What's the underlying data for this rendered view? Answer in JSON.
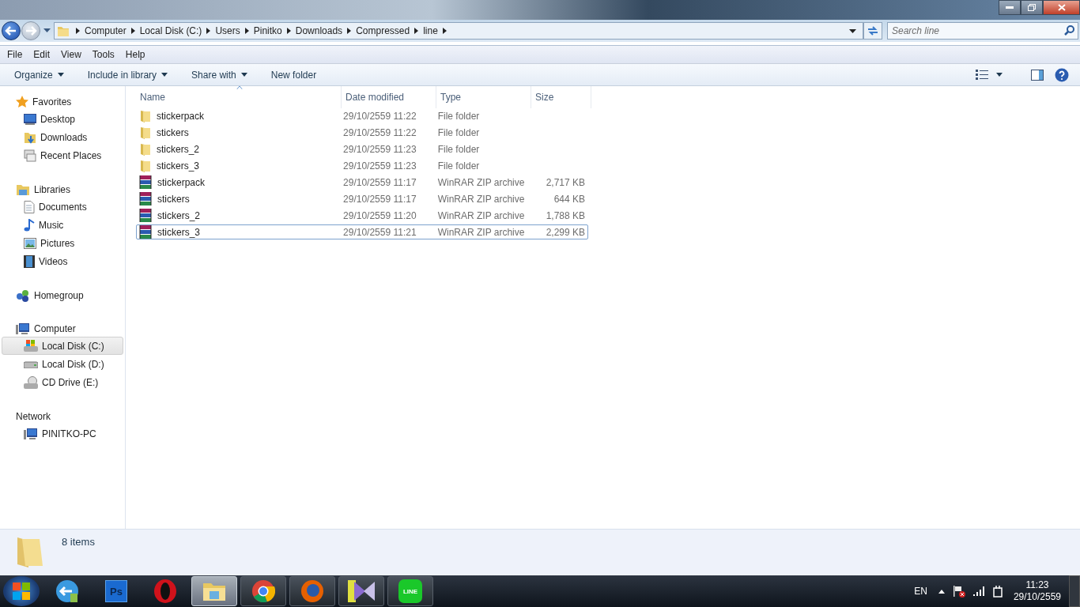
{
  "address": {
    "breadcrumbs": [
      "Computer",
      "Local Disk (C:)",
      "Users",
      "Pinitko",
      "Downloads",
      "Compressed",
      "line"
    ]
  },
  "search": {
    "placeholder": "Search line"
  },
  "menu": [
    "File",
    "Edit",
    "View",
    "Tools",
    "Help"
  ],
  "commands": [
    {
      "label": "Organize",
      "dropdown": true
    },
    {
      "label": "Include in library",
      "dropdown": true
    },
    {
      "label": "Share with",
      "dropdown": true
    },
    {
      "label": "New folder",
      "dropdown": false
    }
  ],
  "sidebar": [
    {
      "label": "Favorites",
      "kind": "star",
      "children": [
        {
          "label": "Desktop",
          "kind": "desktop",
          "selected": false
        },
        {
          "label": "Downloads",
          "kind": "downloads",
          "selected": false
        },
        {
          "label": "Recent Places",
          "kind": "recent",
          "selected": false
        }
      ]
    },
    {
      "label": "Libraries",
      "kind": "library",
      "children": [
        {
          "label": "Documents",
          "kind": "document",
          "selected": false
        },
        {
          "label": "Music",
          "kind": "music",
          "selected": false
        },
        {
          "label": "Pictures",
          "kind": "picture",
          "selected": false
        },
        {
          "label": "Videos",
          "kind": "video",
          "selected": false
        }
      ]
    },
    {
      "label": "Homegroup",
      "kind": "homegroup"
    },
    {
      "label": "Computer",
      "kind": "computer",
      "children": [
        {
          "label": "Local Disk (C:)",
          "kind": "sysdisk",
          "selected": true
        },
        {
          "label": "Local Disk (D:)",
          "kind": "disk",
          "selected": false
        },
        {
          "label": "CD Drive (E:)",
          "kind": "cd",
          "selected": false
        }
      ]
    },
    {
      "label": "Network",
      "kind": "network",
      "children": [
        {
          "label": "PINITKO-PC",
          "kind": "computer",
          "selected": false
        }
      ]
    }
  ],
  "columns": [
    {
      "label": "Name",
      "sorted": true
    },
    {
      "label": "Date modified",
      "sorted": false
    },
    {
      "label": "Type",
      "sorted": false
    },
    {
      "label": "Size",
      "sorted": false
    }
  ],
  "files": [
    {
      "name": "stickerpack",
      "kind": "folder",
      "date": "29/10/2559 11:22",
      "type": "File folder",
      "selected": false
    },
    {
      "name": "stickers",
      "kind": "folder",
      "date": "29/10/2559 11:22",
      "type": "File folder",
      "selected": false
    },
    {
      "name": "stickers_2",
      "kind": "folder",
      "date": "29/10/2559 11:23",
      "type": "File folder",
      "selected": false
    },
    {
      "name": "stickers_3",
      "kind": "folder",
      "date": "29/10/2559 11:23",
      "type": "File folder",
      "selected": false
    },
    {
      "name": "stickerpack",
      "kind": "zip",
      "date": "29/10/2559 11:17",
      "type": "WinRAR ZIP archive",
      "size": "2,717 KB",
      "selected": false
    },
    {
      "name": "stickers",
      "kind": "zip",
      "date": "29/10/2559 11:17",
      "type": "WinRAR ZIP archive",
      "size": "644 KB",
      "selected": false
    },
    {
      "name": "stickers_2",
      "kind": "zip",
      "date": "29/10/2559 11:20",
      "type": "WinRAR ZIP archive",
      "size": "1,788 KB",
      "selected": false
    },
    {
      "name": "stickers_3",
      "kind": "zip",
      "date": "29/10/2559 11:21",
      "type": "WinRAR ZIP archive",
      "size": "2,299 KB",
      "selected": true
    }
  ],
  "status": {
    "count": "8 items"
  },
  "taskbar": {
    "items": [
      {
        "kind": "sync",
        "running": false,
        "selected": false
      },
      {
        "kind": "photoshop",
        "glyph": "Ps",
        "running": false,
        "selected": false
      },
      {
        "kind": "opera",
        "running": false,
        "selected": false
      },
      {
        "kind": "explorer",
        "running": true,
        "selected": true
      },
      {
        "kind": "chrome",
        "running": true,
        "selected": false
      },
      {
        "kind": "firefox",
        "running": true,
        "selected": false
      },
      {
        "kind": "player",
        "running": true,
        "selected": false
      },
      {
        "kind": "chat",
        "glyph": "LINE",
        "running": true,
        "selected": false
      }
    ],
    "language": "EN",
    "time": "11:23",
    "date": "29/10/2559"
  }
}
